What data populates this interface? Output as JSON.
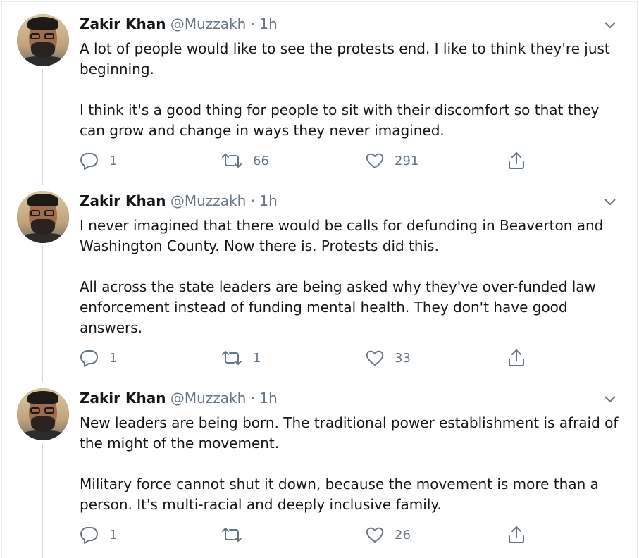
{
  "tweets": [
    {
      "author_name": "Zakir Khan",
      "handle": "@Muzzakh",
      "separator": "·",
      "time": "1h",
      "paragraphs": [
        "A lot of people would like to see the protests end. I like to think they're just beginning.",
        "I think it's a good thing for people to sit with their discomfort so that they can grow and change in ways they never imagined."
      ],
      "reply_count": "1",
      "retweet_count": "66",
      "like_count": "291"
    },
    {
      "author_name": "Zakir Khan",
      "handle": "@Muzzakh",
      "separator": "·",
      "time": "1h",
      "paragraphs": [
        "I never imagined that there would be calls for defunding in Beaverton and Washington County. Now there is. Protests did this.",
        "All across the state leaders are being asked why they've over-funded law enforcement instead of funding mental health. They don't have good answers."
      ],
      "reply_count": "1",
      "retweet_count": "1",
      "like_count": "33"
    },
    {
      "author_name": "Zakir Khan",
      "handle": "@Muzzakh",
      "separator": "·",
      "time": "1h",
      "paragraphs": [
        "New leaders are being born. The traditional power establishment is afraid of the might of the movement.",
        "Military force cannot shut it down, because the movement is more than a person. It's multi-racial and deeply inclusive family."
      ],
      "reply_count": "1",
      "retweet_count": "",
      "like_count": "26"
    }
  ],
  "icons": {
    "reply": "reply-icon",
    "retweet": "retweet-icon",
    "like": "heart-icon",
    "share": "share-icon",
    "menu": "chevron-down-icon"
  },
  "colors": {
    "text": "#14171a",
    "secondary": "#657786",
    "thread_line": "#ccd6dd",
    "border": "#e6ecf0"
  }
}
